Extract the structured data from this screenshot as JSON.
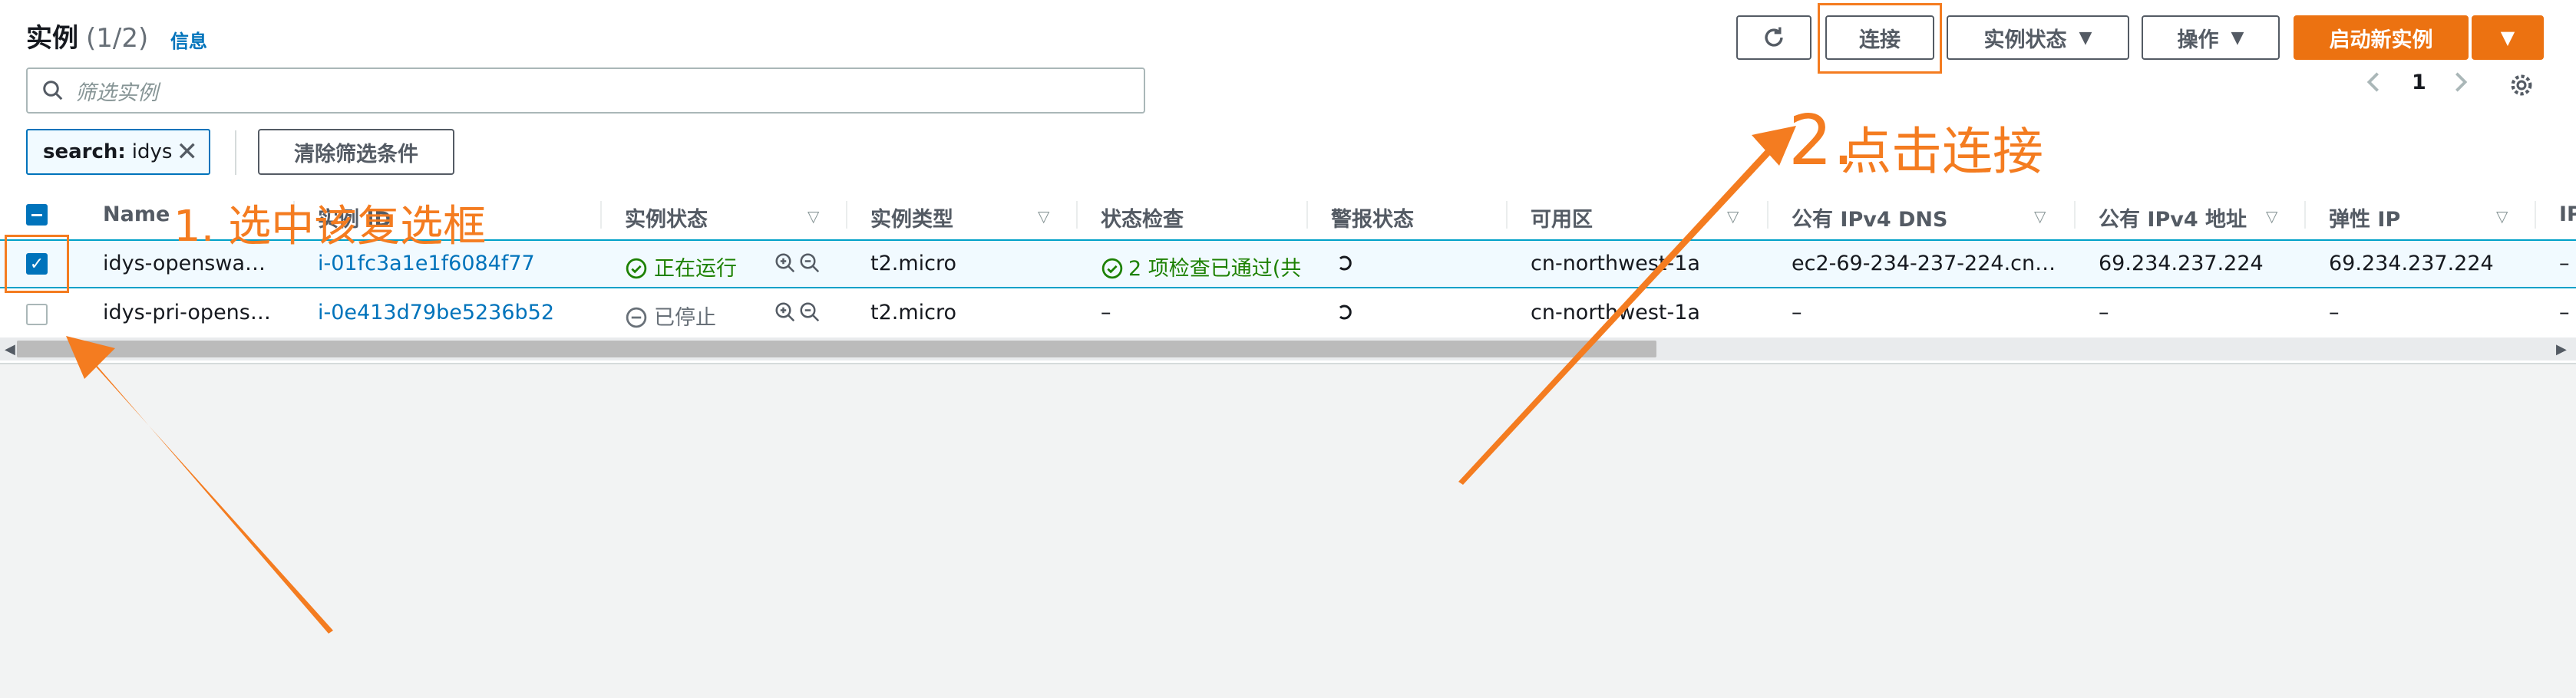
{
  "header": {
    "title": "实例",
    "count": "(1/2)",
    "info": "信息",
    "buttons": {
      "refresh_icon": "refresh-icon",
      "connect": "连接",
      "instance_state": "实例状态",
      "actions": "操作",
      "launch": "启动新实例"
    }
  },
  "search": {
    "placeholder": "筛选实例",
    "token_key": "search:",
    "token_value": "idys",
    "clear": "清除筛选条件"
  },
  "pagination": {
    "page": "1"
  },
  "table": {
    "columns": [
      "Name",
      "实例 ID",
      "实例状态",
      "实例类型",
      "状态检查",
      "警报状态",
      "可用区",
      "公有 IPv4 DNS",
      "公有 IPv4 地址",
      "弹性 IP",
      "IP"
    ],
    "rows": [
      {
        "selected": true,
        "name": "idys-openswa…",
        "id": "i-01fc3a1e1f6084f77",
        "state": "正在运行",
        "type": "t2.micro",
        "check": "2 项检查已通过(共",
        "zone": "cn-northwest-1a",
        "dns": "ec2-69-234-237-224.cn…",
        "ipv4": "69.234.237.224",
        "eip": "69.234.237.224",
        "extra": "–"
      },
      {
        "selected": false,
        "name": "idys-pri-opens…",
        "id": "i-0e413d79be5236b52",
        "state": "已停止",
        "type": "t2.micro",
        "check": "–",
        "zone": "cn-northwest-1a",
        "dns": "–",
        "ipv4": "–",
        "eip": "–",
        "extra": "–"
      }
    ]
  },
  "annotations": {
    "step1": "1.   选中该复选框",
    "step2_num": "2.",
    "step2_text": "点击连接"
  },
  "colors": {
    "accent": "#ec7211",
    "annotation": "#f47c20",
    "link": "#0073bb",
    "success": "#1d8102"
  }
}
